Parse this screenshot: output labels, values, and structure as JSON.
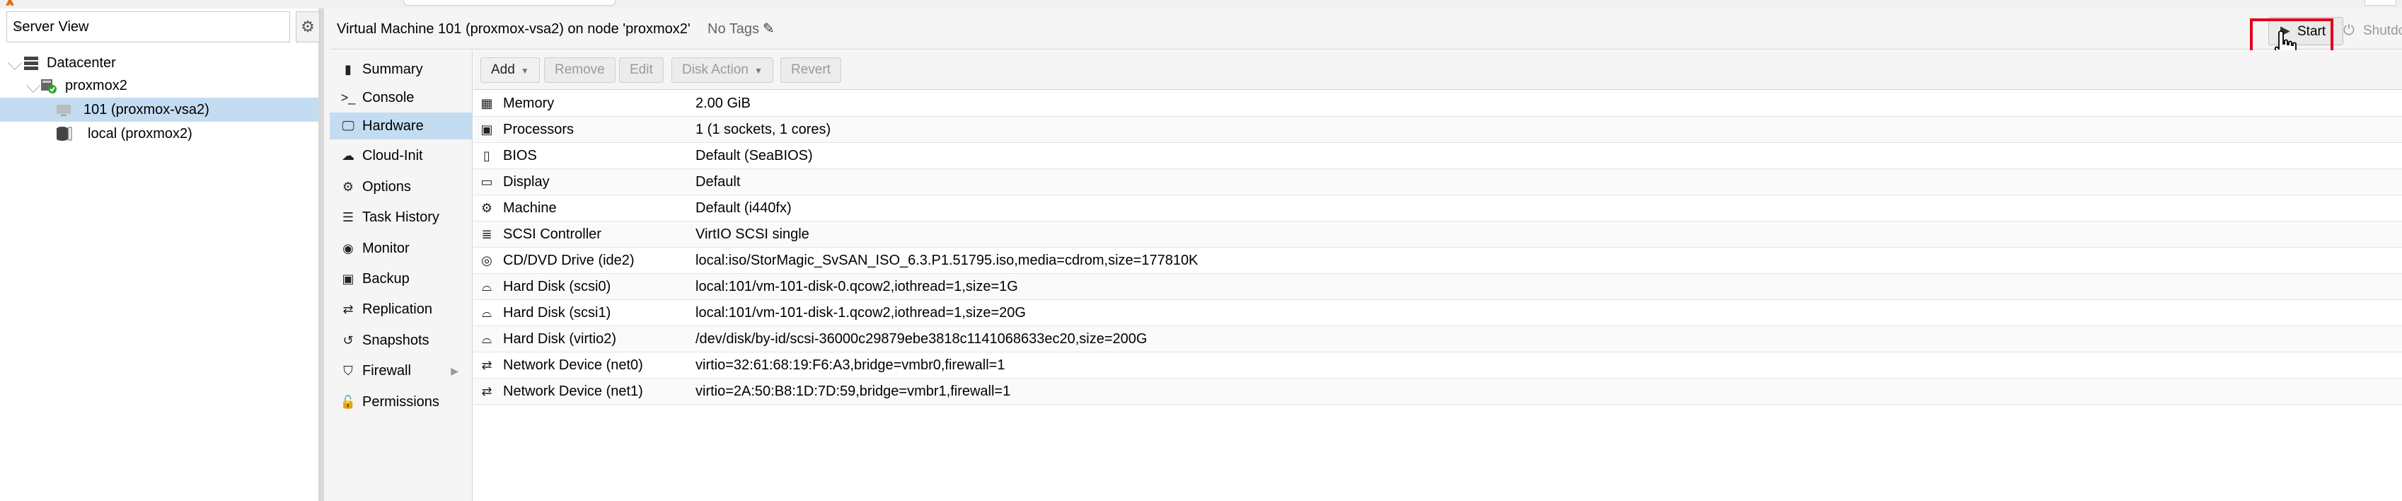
{
  "tree": {
    "view_select": "Server View",
    "nodes": [
      {
        "label": "Datacenter",
        "icon": "datacenter-icon"
      },
      {
        "label": "proxmox2",
        "icon": "node-online-icon"
      },
      {
        "label": "101 (proxmox-vsa2)",
        "icon": "vm-icon"
      },
      {
        "label": "local (proxmox2)",
        "icon": "storage-icon"
      }
    ]
  },
  "header": {
    "title": "Virtual Machine 101 (proxmox-vsa2) on node 'proxmox2'",
    "tags": "No Tags",
    "start_label": "Start",
    "shutdown_label": "Shutdo",
    "accent_highlight": "#e0001a"
  },
  "nav": {
    "items": [
      {
        "label": "Summary",
        "icon": "book-icon"
      },
      {
        "label": "Console",
        "icon": "terminal-icon"
      },
      {
        "label": "Hardware",
        "icon": "monitor-icon",
        "active": true
      },
      {
        "label": "Cloud-Init",
        "icon": "cloud-icon"
      },
      {
        "label": "Options",
        "icon": "gear-icon"
      },
      {
        "label": "Task History",
        "icon": "list-icon"
      },
      {
        "label": "Monitor",
        "icon": "eye-icon"
      },
      {
        "label": "Backup",
        "icon": "floppy-icon"
      },
      {
        "label": "Replication",
        "icon": "retweet-icon"
      },
      {
        "label": "Snapshots",
        "icon": "history-icon"
      },
      {
        "label": "Firewall",
        "icon": "shield-icon"
      },
      {
        "label": "Permissions",
        "icon": "unlock-icon"
      }
    ]
  },
  "toolbar": {
    "add": "Add",
    "remove": "Remove",
    "edit": "Edit",
    "disk_action": "Disk Action",
    "revert": "Revert"
  },
  "hardware": {
    "rows": [
      {
        "name": "Memory",
        "value": "2.00 GiB",
        "icon": "memory-icon"
      },
      {
        "name": "Processors",
        "value": "1 (1 sockets, 1 cores)",
        "icon": "cpu-icon"
      },
      {
        "name": "BIOS",
        "value": "Default (SeaBIOS)",
        "icon": "microchip-icon"
      },
      {
        "name": "Display",
        "value": "Default",
        "icon": "desktop-icon"
      },
      {
        "name": "Machine",
        "value": "Default (i440fx)",
        "icon": "cogs-icon"
      },
      {
        "name": "SCSI Controller",
        "value": "VirtIO SCSI single",
        "icon": "database-icon"
      },
      {
        "name": "CD/DVD Drive (ide2)",
        "value": "local:iso/StorMagic_SvSAN_ISO_6.3.P1.51795.iso,media=cdrom,size=177810K",
        "icon": "cdrom-icon"
      },
      {
        "name": "Hard Disk (scsi0)",
        "value": "local:101/vm-101-disk-0.qcow2,iothread=1,size=1G",
        "icon": "hdd-icon"
      },
      {
        "name": "Hard Disk (scsi1)",
        "value": "local:101/vm-101-disk-1.qcow2,iothread=1,size=20G",
        "icon": "hdd-icon"
      },
      {
        "name": "Hard Disk (virtio2)",
        "value": "/dev/disk/by-id/scsi-36000c29879ebe3818c1141068633ec20,size=200G",
        "icon": "hdd-icon"
      },
      {
        "name": "Network Device (net0)",
        "value": "virtio=32:61:68:19:F6:A3,bridge=vmbr0,firewall=1",
        "icon": "exchange-icon"
      },
      {
        "name": "Network Device (net1)",
        "value": "virtio=2A:50:B8:1D:7D:59,bridge=vmbr1,firewall=1",
        "icon": "exchange-icon"
      }
    ]
  }
}
